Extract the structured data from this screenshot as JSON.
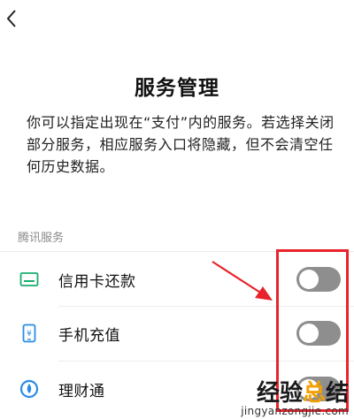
{
  "header": {
    "back_icon": "chevron-left-icon"
  },
  "page": {
    "title": "服务管理",
    "description": "你可以指定出现在“支付”内的服务。若选择关闭部分服务，相应服务入口将隐藏，但不会清空任何历史数据。"
  },
  "section": {
    "label": "腾讯服务",
    "items": [
      {
        "label": "信用卡还款",
        "icon": "credit-card-icon",
        "icon_color": "#1aad6d",
        "enabled": false
      },
      {
        "label": "手机充值",
        "icon": "phone-recharge-icon",
        "icon_color": "#2b8ce8",
        "enabled": false
      },
      {
        "label": "理财通",
        "icon": "wealth-management-icon",
        "icon_color": "#2b8ce8",
        "enabled": false
      }
    ]
  },
  "annotation": {
    "color": "#e8232b"
  },
  "watermark": {
    "main_part1": "经验",
    "main_accent": "总",
    "main_part2": "结",
    "sub": "jingyanzongjie.com"
  }
}
